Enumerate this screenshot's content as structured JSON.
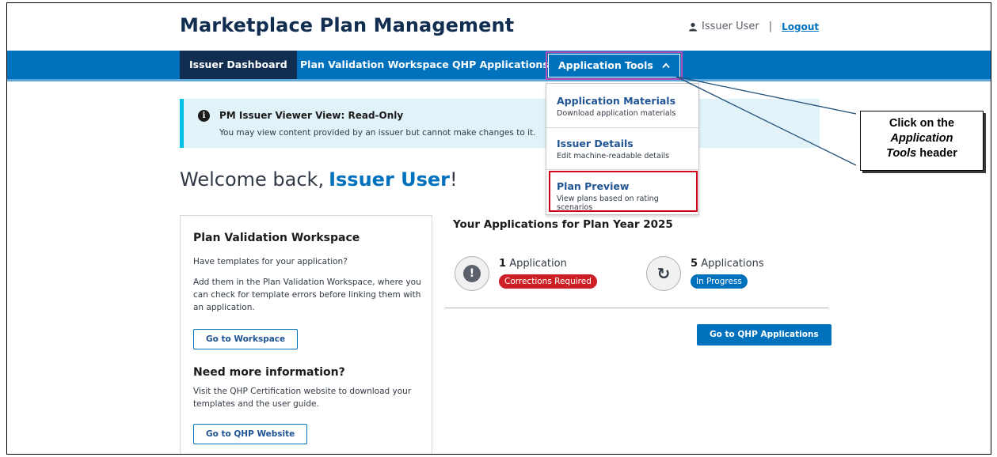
{
  "site": {
    "title": "Marketplace Plan Management"
  },
  "user": {
    "name": "Issuer User",
    "separator": "|",
    "logout": "Logout"
  },
  "nav": {
    "items": [
      {
        "label": "Issuer Dashboard"
      },
      {
        "label": "Plan Validation Workspace"
      },
      {
        "label": "QHP Applications"
      },
      {
        "label": "Application Tools"
      }
    ],
    "tools_chevron": "^"
  },
  "dropdown": {
    "items": [
      {
        "title": "Application Materials",
        "desc": "Download application materials"
      },
      {
        "title": "Issuer Details",
        "desc": "Edit machine-readable details"
      },
      {
        "title": "Plan Preview",
        "desc": "View plans based on rating scenarios"
      }
    ]
  },
  "alert": {
    "icon": "info-icon",
    "title": "PM Issuer Viewer View: Read-Only",
    "body": "You may view content provided by an issuer but cannot make changes to it."
  },
  "welcome": {
    "prefix": "Welcome back,",
    "name": "Issuer User",
    "suffix": "!"
  },
  "workspace_card": {
    "heading": "Plan Validation Workspace",
    "question": "Have templates for your application?",
    "body": "Add them in the Plan Validation Workspace, where you can check for template errors before linking them with an application.",
    "button": "Go to Workspace",
    "info_heading": "Need more information?",
    "info_body": "Visit the QHP Certification website to download your templates and the user guide.",
    "info_button": "Go to QHP Website"
  },
  "applications": {
    "title": "Your Applications for Plan Year 2025",
    "corrections": {
      "count": "1",
      "unit": "Application",
      "badge": "Corrections Required",
      "color": "#cd2026"
    },
    "in_progress": {
      "count": "5",
      "unit": "Applications",
      "badge": "In Progress",
      "color": "#0071bc"
    },
    "button": "Go to QHP Applications"
  },
  "callout": {
    "line1": "Click on the",
    "line2": "Application",
    "line3_italic": "Tools",
    "line3_rest": " header"
  },
  "colors": {
    "brand": "#0071bc",
    "nav_active": "#112e51",
    "highlight_purple": "#b44cb6",
    "highlight_red": "#d0021b"
  }
}
